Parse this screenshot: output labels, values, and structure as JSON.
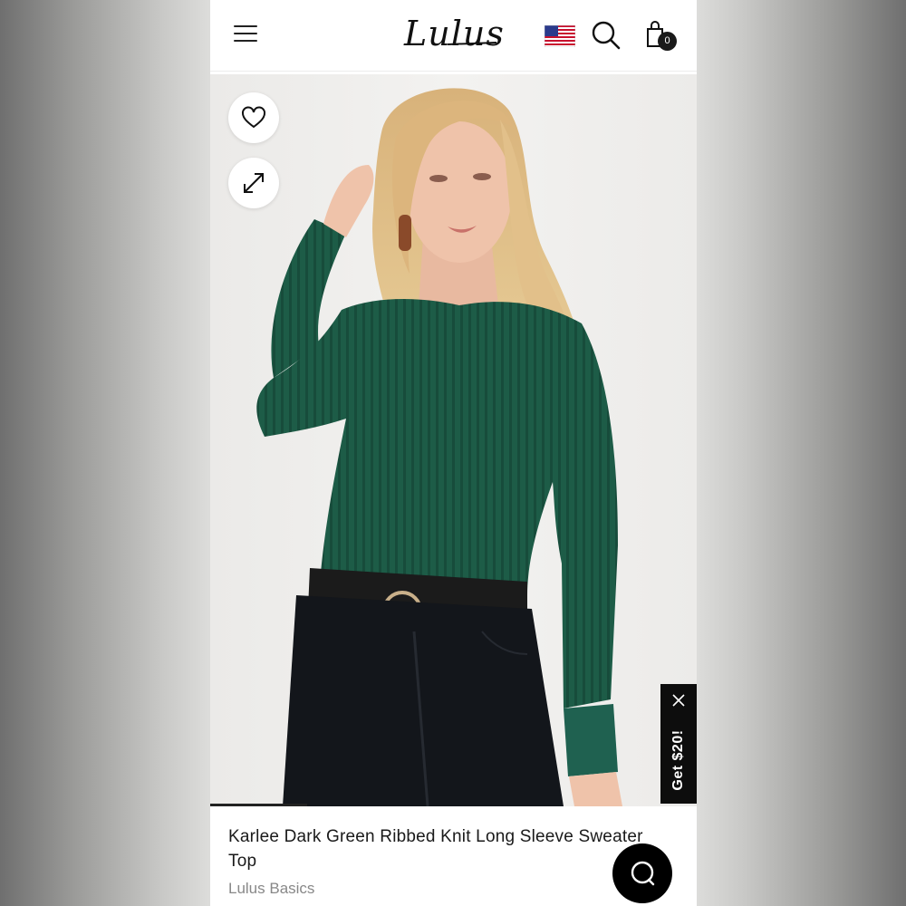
{
  "header": {
    "brand_logo": "Lulus",
    "menu_icon": "hamburger-menu-icon",
    "flag_icon": "us-flag-icon",
    "search_icon": "search-icon",
    "bag_icon": "shopping-bag-icon",
    "bag_count": "0"
  },
  "gallery": {
    "wishlist_icon": "heart-icon",
    "expand_icon": "expand-icon",
    "image_description": "product-photo"
  },
  "promo": {
    "label": "Get $20!",
    "close_icon": "close-icon"
  },
  "product": {
    "title": "Karlee Dark Green Ribbed Knit Long Sleeve Sweater Top",
    "brand": "Lulus Basics"
  },
  "chat": {
    "icon": "chat-icon"
  },
  "colors": {
    "sweater": "#1c5a46",
    "jeans": "#12151a",
    "background": "#f1f0ee",
    "accent": "#000000"
  }
}
